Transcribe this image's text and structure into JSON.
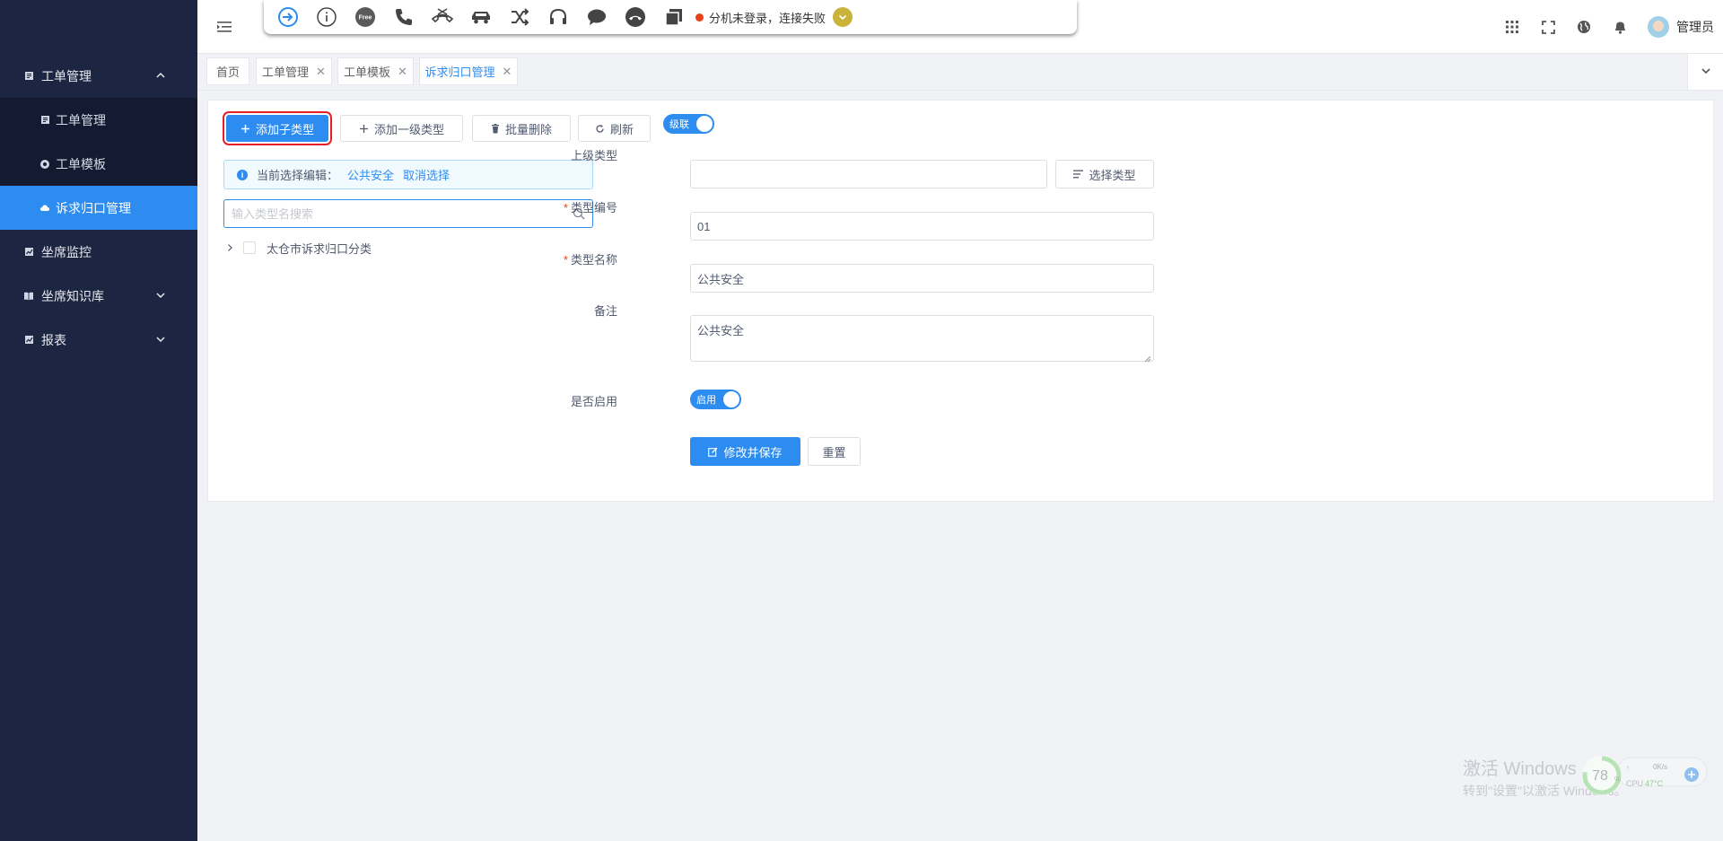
{
  "sidebar": {
    "groups": [
      {
        "label": "工单管理",
        "icon": "document-icon"
      },
      {
        "label": "坐席监控",
        "icon": "chart-icon"
      },
      {
        "label": "坐席知识库",
        "icon": "book-icon"
      },
      {
        "label": "报表",
        "icon": "chart-icon"
      }
    ],
    "subitems": [
      {
        "label": "工单管理",
        "icon": "document-icon"
      },
      {
        "label": "工单模板",
        "icon": "gear-icon"
      },
      {
        "label": "诉求归口管理",
        "icon": "cloud-icon",
        "active": true
      }
    ]
  },
  "softphone": {
    "free_badge": "Free",
    "status": "分机未登录，连接失败",
    "status_color": "#e84118"
  },
  "header": {
    "user_name": "管理员"
  },
  "tabs": [
    {
      "label": "首页",
      "closable": false
    },
    {
      "label": "工单管理",
      "closable": true
    },
    {
      "label": "工单模板",
      "closable": true
    },
    {
      "label": "诉求归口管理",
      "closable": true,
      "active": true
    }
  ],
  "toolbar": {
    "add_child": "添加子类型",
    "add_top": "添加一级类型",
    "batch_delete": "批量删除",
    "refresh": "刷新",
    "cascade_switch": "级联"
  },
  "selection": {
    "prefix": "当前选择编辑：",
    "selected": "公共安全",
    "cancel": "取消选择"
  },
  "search": {
    "placeholder": "输入类型名搜索"
  },
  "tree": {
    "root": "太仓市诉求归口分类"
  },
  "form": {
    "parent_label": "上级类型",
    "parent_value": "",
    "select_type_button": "选择类型",
    "code_label": "类型编号",
    "code_value": "01",
    "name_label": "类型名称",
    "name_value": "公共安全",
    "remark_label": "备注",
    "remark_value": "公共安全",
    "enabled_label": "是否启用",
    "enabled_switch": "启用",
    "save_button": "修改并保存",
    "reset_button": "重置"
  },
  "watermark": {
    "line1": "激活 Windows",
    "line2": "转到\"设置\"以激活 Windows。"
  },
  "perf_widget": {
    "cpu_percent": "78",
    "percent_sign": "%",
    "net_speed": "0K/s",
    "cpu_label": "CPU",
    "cpu_temp": "47°C"
  },
  "colors": {
    "sidebar_bg": "#1c2541",
    "accent": "#2d8cf0",
    "danger_outline": "#e81e25"
  }
}
